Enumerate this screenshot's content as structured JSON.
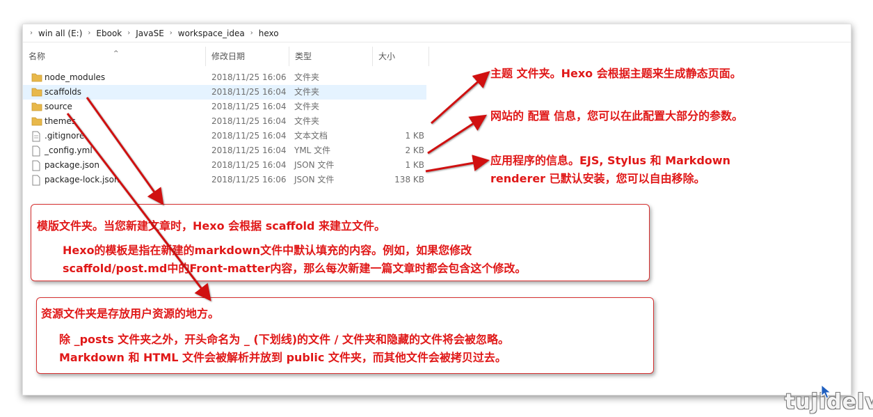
{
  "breadcrumb": [
    "win all (E:)",
    "Ebook",
    "JavaSE",
    "workspace_idea",
    "hexo"
  ],
  "columns": {
    "name": "名称",
    "date": "修改日期",
    "type": "类型",
    "size": "大小"
  },
  "files": [
    {
      "name": "node_modules",
      "date": "2018/11/25 16:06",
      "type": "文件夹",
      "size": "",
      "icon": "folder-icon"
    },
    {
      "name": "scaffolds",
      "date": "2018/11/25 16:04",
      "type": "文件夹",
      "size": "",
      "icon": "folder-icon"
    },
    {
      "name": "source",
      "date": "2018/11/25 16:04",
      "type": "文件夹",
      "size": "",
      "icon": "folder-icon"
    },
    {
      "name": "themes",
      "date": "2018/11/25 16:04",
      "type": "文件夹",
      "size": "",
      "icon": "folder-icon"
    },
    {
      "name": ".gitignore",
      "date": "2018/11/25 16:04",
      "type": "文本文档",
      "size": "1 KB",
      "icon": "text-file-icon"
    },
    {
      "name": "_config.yml",
      "date": "2018/11/25 16:04",
      "type": "YML 文件",
      "size": "2 KB",
      "icon": "file-icon"
    },
    {
      "name": "package.json",
      "date": "2018/11/25 16:04",
      "type": "JSON 文件",
      "size": "1 KB",
      "icon": "file-icon"
    },
    {
      "name": "package-lock.json",
      "date": "2018/11/25 16:06",
      "type": "JSON 文件",
      "size": "138 KB",
      "icon": "file-icon"
    }
  ],
  "annotations": {
    "themes": "主题 文件夹。Hexo 会根据主题来生成静态页面。",
    "config": "网站的 配置 信息，您可以在此配置大部分的参数。",
    "package_line1": "应用程序的信息。EJS, Stylus 和 Markdown",
    "package_line2": "renderer 已默认安装，您可以自由移除。",
    "scaffolds_title": "模版文件夹。当您新建文章时，Hexo 会根据 scaffold 来建立文件。",
    "scaffolds_line1": "Hexo的模板是指在新建的markdown文件中默认填充的内容。例如，如果您修改",
    "scaffolds_line2": "scaffold/post.md中的Front-matter内容，那么每次新建一篇文章时都会包含这个修改。",
    "source_title": "资源文件夹是存放用户资源的地方。",
    "source_line1": "除 _posts 文件夹之外，开头命名为 _ (下划线)的文件 / 文件夹和隐藏的文件将会被忽略。",
    "source_line2": "Markdown 和 HTML 文件会被解析并放到 public 文件夹，而其他文件会被拷贝过去。"
  },
  "colors": {
    "annotation": "#e01818",
    "selection": "#e5f3ff",
    "folder": "#e8b84a"
  },
  "watermark": "tujidelv"
}
